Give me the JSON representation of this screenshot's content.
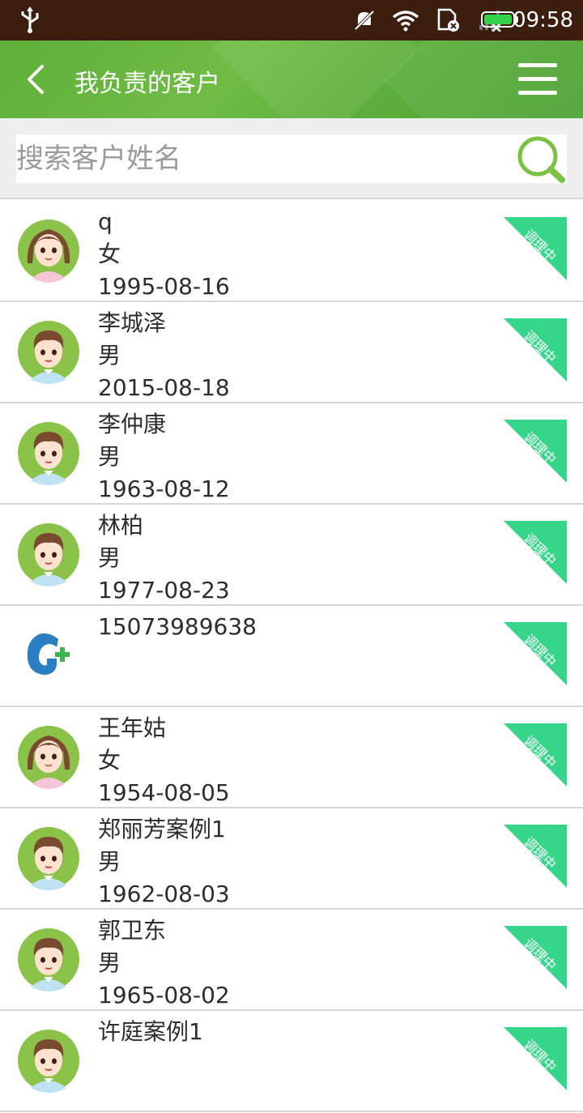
{
  "status_bar": {
    "time": "09:58"
  },
  "header": {
    "title": "我负责的客户"
  },
  "search": {
    "placeholder": "搜索客户姓名"
  },
  "badge_colors": {
    "green": "#36d68a"
  },
  "customers": [
    {
      "name": "q",
      "gender": "女",
      "birth": "1995-08-16",
      "status": "调理中",
      "avatar": "female-avatar"
    },
    {
      "name": "李城泽",
      "gender": "男",
      "birth": "2015-08-18",
      "status": "调理中",
      "avatar": "male-avatar"
    },
    {
      "name": "李仲康",
      "gender": "男",
      "birth": "1963-08-12",
      "status": "调理中",
      "avatar": "male-avatar"
    },
    {
      "name": "林柏",
      "gender": "男",
      "birth": "1977-08-23",
      "status": "调理中",
      "avatar": "male-avatar"
    },
    {
      "name": "15073989638",
      "gender": "",
      "birth": "",
      "status": "调理中",
      "avatar": "logo-avatar"
    },
    {
      "name": "王年姑",
      "gender": "女",
      "birth": "1954-08-05",
      "status": "调理中",
      "avatar": "female-avatar"
    },
    {
      "name": "郑丽芳案例1",
      "gender": "男",
      "birth": "1962-08-03",
      "status": "调理中",
      "avatar": "male-avatar"
    },
    {
      "name": "郭卫东",
      "gender": "男",
      "birth": "1965-08-02",
      "status": "调理中",
      "avatar": "male-avatar"
    },
    {
      "name": "许庭案例1",
      "gender": "",
      "birth": "",
      "status": "调理中",
      "avatar": "male-avatar"
    }
  ]
}
